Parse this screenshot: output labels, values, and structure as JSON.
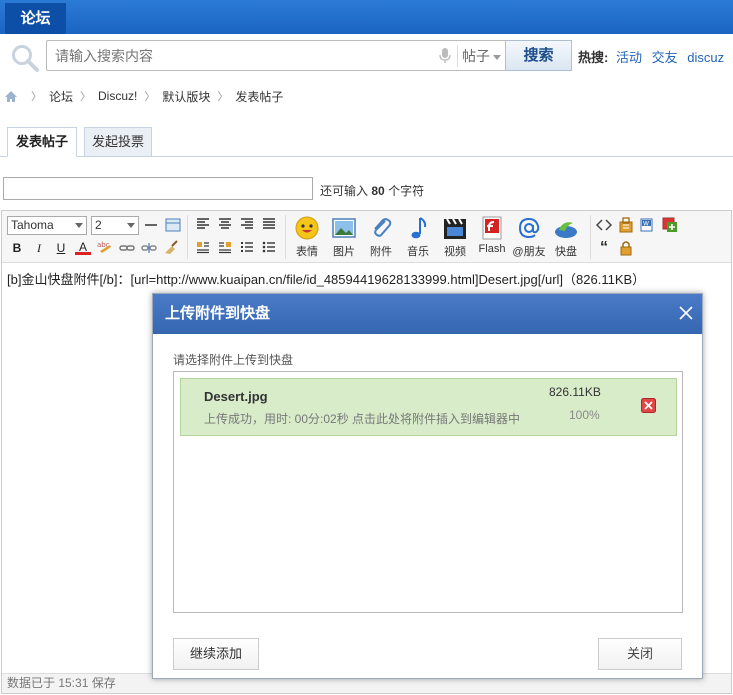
{
  "nav": {
    "tab_label": "论坛"
  },
  "search": {
    "placeholder": "请输入搜索内容",
    "scope": "帖子",
    "button": "搜索",
    "hot_label": "热搜:",
    "hot_links": [
      "活动",
      "交友",
      "discuz"
    ]
  },
  "breadcrumb": [
    "论坛",
    "Discuz!",
    "默认版块",
    "发表帖子"
  ],
  "tabs": [
    "发表帖子",
    "发起投票"
  ],
  "subject": {
    "hint_prefix": "还可输入",
    "remaining": "80",
    "hint_suffix": "个字符"
  },
  "toolbar": {
    "font": "Tahoma",
    "size": "2",
    "bold": "B",
    "italic": "I",
    "underline": "U",
    "color": "A",
    "big_buttons": [
      "表情",
      "图片",
      "附件",
      "音乐",
      "视频",
      "Flash",
      "@朋友",
      "快盘"
    ],
    "quote": "“"
  },
  "editor": {
    "content": "[b]金山快盘附件[/b]：[url=http://www.kuaipan.cn/file/id_48594419628133999.html]Desert.jpg[/url]（826.11KB）",
    "status": "数据已于 15:31 保存"
  },
  "dialog": {
    "title": "上传附件到快盘",
    "label": "请选择附件上传到快盘",
    "file": {
      "name": "Desert.jpg",
      "status": "上传成功，用时: 00分:02秒 点击此处将附件插入到编辑器中",
      "size": "826.11KB",
      "percent": "100%"
    },
    "add_button": "继续添加",
    "close_button": "关闭"
  }
}
